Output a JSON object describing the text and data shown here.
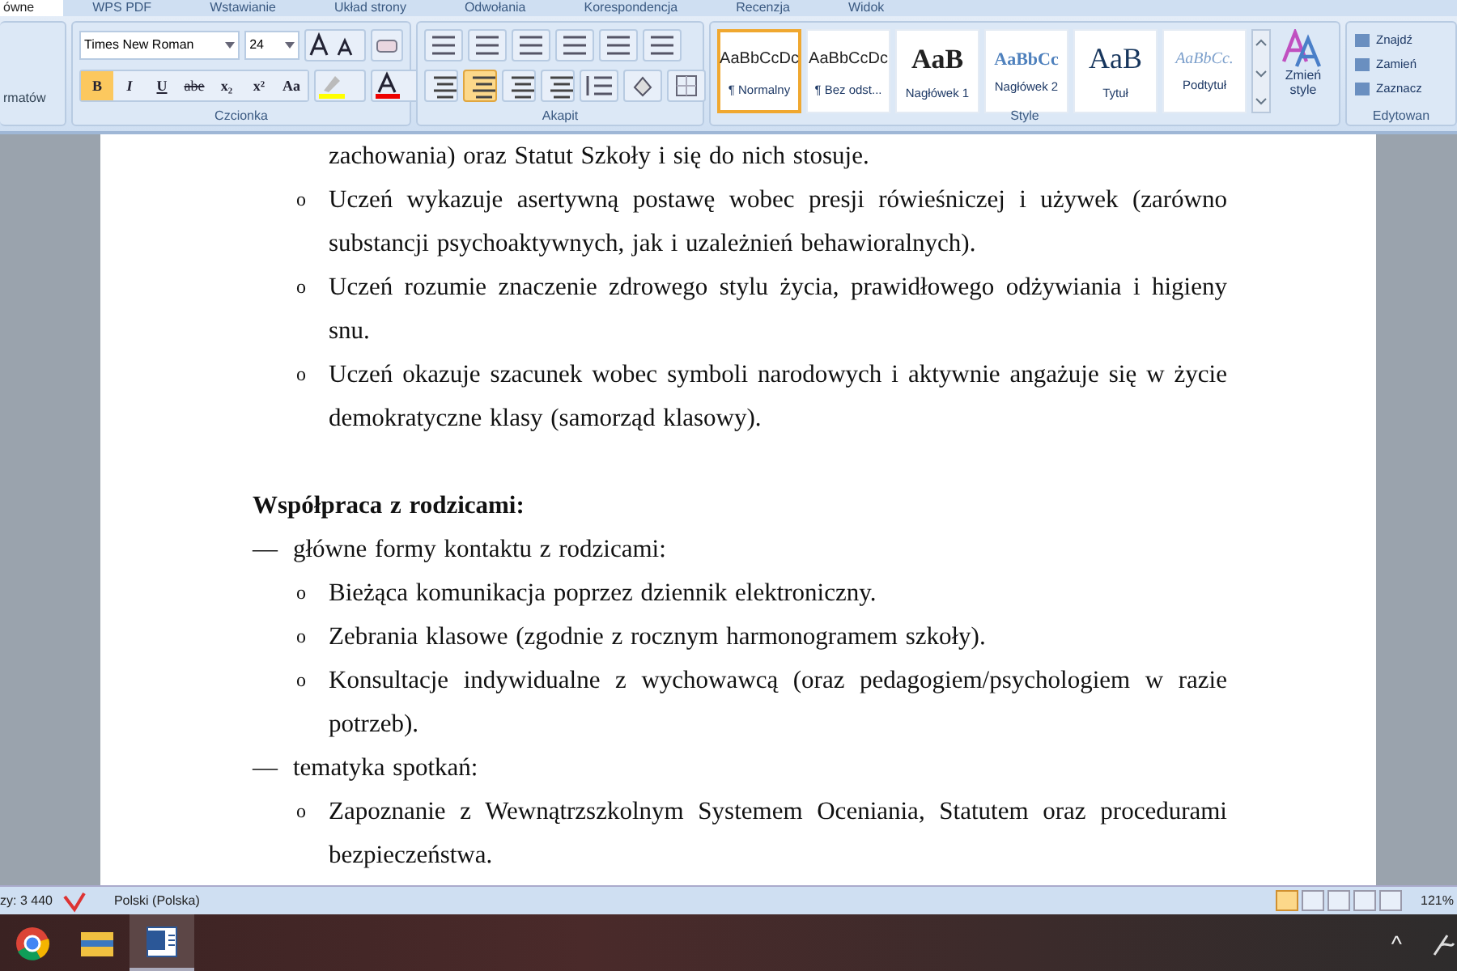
{
  "ribbon": {
    "tabs": [
      {
        "label": "ówne",
        "selected": true
      },
      {
        "label": "WPS PDF",
        "selected": false
      },
      {
        "label": "Wstawianie",
        "selected": false
      },
      {
        "label": "Układ strony",
        "selected": false
      },
      {
        "label": "Odwołania",
        "selected": false
      },
      {
        "label": "Korespondencja",
        "selected": false
      },
      {
        "label": "Recenzja",
        "selected": false
      },
      {
        "label": "Widok",
        "selected": false
      }
    ],
    "clipboard_group_fragment": "rmatów",
    "font_group": {
      "label": "Czcionka",
      "font_name": "Times New Roman",
      "font_size": "24",
      "format_buttons": [
        {
          "label": "B",
          "selected": true
        },
        {
          "label": "I",
          "selected": false
        },
        {
          "label": "U",
          "selected": false
        },
        {
          "label": "abe",
          "selected": false
        },
        {
          "label": "x₂",
          "selected": false
        },
        {
          "label": "x²",
          "selected": false
        },
        {
          "label": "Aa",
          "selected": false
        }
      ]
    },
    "paragraph_group": {
      "label": "Akapit",
      "alignment": [
        {
          "selected": false
        },
        {
          "selected": true
        },
        {
          "selected": false
        },
        {
          "selected": false
        }
      ]
    },
    "styles_group": {
      "label": "Style",
      "styles": [
        {
          "preview": "AaBbCcDc",
          "label": "¶ Normalny",
          "selected": true
        },
        {
          "preview": "AaBbCcDc",
          "label": "¶ Bez odst...",
          "selected": false
        },
        {
          "preview": "AaB",
          "label": "Nagłówek 1",
          "selected": false
        },
        {
          "preview": "AaBbCc",
          "label": "Nagłówek 2",
          "selected": false
        },
        {
          "preview": "AaB",
          "label": "Tytuł",
          "selected": false
        },
        {
          "preview": "AaBbCc.",
          "label": "Podtytuł",
          "selected": false
        }
      ],
      "change_styles": "Zmień style"
    },
    "editing_group": {
      "label": "Edytowan",
      "items": [
        "Znajdź",
        "Zamień",
        "Zaznacz"
      ]
    }
  },
  "document": {
    "blocks": [
      {
        "kind": "continuation",
        "text": "zachowania) oraz Statut Szkoły i się do nich stosuje."
      },
      {
        "kind": "bullet",
        "marker": "o",
        "text": "Uczeń wykazuje asertywną postawę wobec presji rówieśniczej i używek (zarówno substancji psychoaktywnych, jak i uzależnień behawioralnych)."
      },
      {
        "kind": "bullet",
        "marker": "o",
        "text": "Uczeń rozumie znaczenie zdrowego stylu życia, prawidłowego odżywiania i higieny snu."
      },
      {
        "kind": "bullet",
        "marker": "o",
        "text": "Uczeń okazuje szacunek wobec symboli narodowych i aktywnie angażuje się w życie demokratyczne klasy (samorząd klasowy)."
      },
      {
        "kind": "heading",
        "text": "Współpraca z rodzicami:"
      },
      {
        "kind": "dash",
        "marker": "—",
        "text": "główne formy kontaktu z rodzicami:"
      },
      {
        "kind": "bullet",
        "marker": "o",
        "text": "Bieżąca komunikacja poprzez dziennik elektroniczny."
      },
      {
        "kind": "bullet",
        "marker": "o",
        "text": "Zebrania klasowe (zgodnie z rocznym harmonogramem szkoły)."
      },
      {
        "kind": "bullet",
        "marker": "o",
        "text": "Konsultacje indywidualne z wychowawcą (oraz pedagogiem/psychologiem w razie potrzeb)."
      },
      {
        "kind": "dash",
        "marker": "—",
        "text": "tematyka spotkań:"
      },
      {
        "kind": "bullet",
        "marker": "o",
        "text": "Zapoznanie z Wewnątrzszkolnym Systemem Oceniania, Statutem oraz procedurami bezpieczeństwa."
      }
    ]
  },
  "status_bar": {
    "word_count": "zy: 3 440",
    "language": "Polski (Polska)",
    "views": [
      {
        "selected": true
      },
      {
        "selected": false
      },
      {
        "selected": false
      },
      {
        "selected": false
      },
      {
        "selected": false
      }
    ],
    "zoom": "121%"
  },
  "taskbar": {
    "apps": [
      {
        "kind": "browser",
        "selected": false
      },
      {
        "kind": "folder",
        "selected": false
      },
      {
        "kind": "word",
        "selected": true
      }
    ],
    "tray_caret": "^"
  }
}
